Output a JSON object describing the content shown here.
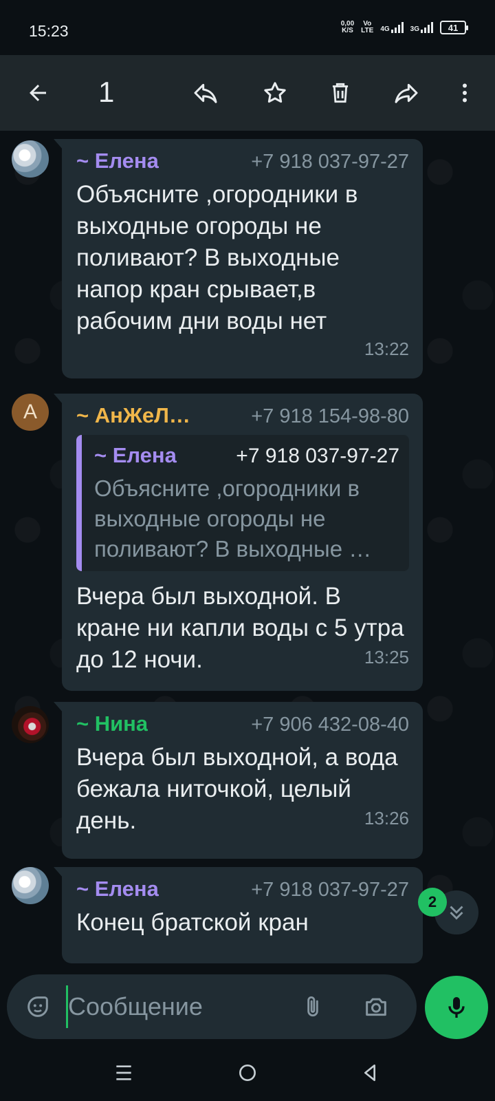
{
  "status_bar": {
    "time": "15:23",
    "net_speed_value": "0,00",
    "net_speed_unit": "K/S",
    "volte_top": "Vo",
    "volte_bottom": "LTE",
    "net1": "4G",
    "net2": "3G",
    "battery": "41"
  },
  "toolbar": {
    "selected_count": "1",
    "icons": [
      "back-arrow-icon",
      "reply-icon",
      "star-icon",
      "delete-icon",
      "forward-icon",
      "more-vert-icon"
    ]
  },
  "messages": [
    {
      "sender": "~ Елена",
      "sender_color": "#a48cf0",
      "phone": "+7 918 037-97-27",
      "text": "Объясните ,огородники в выходные огороды не поливают? В выходные напор кран срывает,в рабочим дни воды нет",
      "time": "13:22"
    },
    {
      "sender": "~ АнЖеЛ…",
      "sender_color": "#f0b64a",
      "avatar_letter": "A",
      "phone": "+7 918 154-98-80",
      "quote": {
        "sender": "~ Елена",
        "phone": "+7 918 037-97-27",
        "text": "Объясните ,огородники в выходные огороды не поливают? В выходные …"
      },
      "text": "Вчера был выходной. В кране ни капли воды с 5 утра до 12 ночи.",
      "time": "13:25"
    },
    {
      "sender": "~ Нина",
      "sender_color": "#21c063",
      "phone": "+7 906 432-08-40",
      "text": "Вчера был выходной, а вода бежала ниточкой, целый день.",
      "time": "13:26"
    },
    {
      "sender": "~ Елена",
      "sender_color": "#a48cf0",
      "phone": "+7 918 037-97-27",
      "text": "Конец братской кран",
      "time": ""
    }
  ],
  "scroll": {
    "unread_count": "2"
  },
  "input": {
    "placeholder": "Сообщение"
  },
  "colors": {
    "accent": "#21c063",
    "bubble": "#202c33",
    "background": "#0b1014"
  }
}
